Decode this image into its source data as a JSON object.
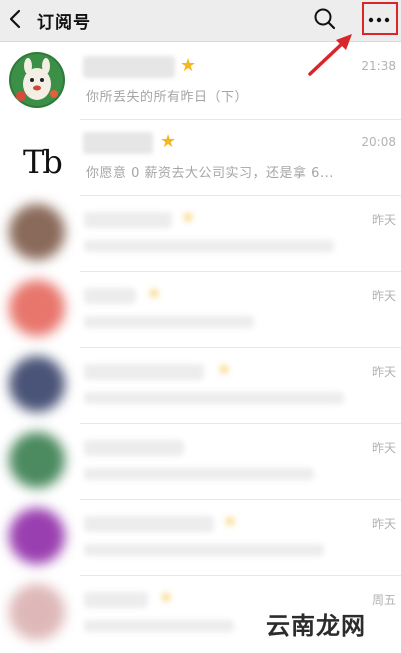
{
  "header": {
    "back_icon": "chevron-left-icon",
    "title": "订阅号",
    "search_icon": "search-icon",
    "more_icon": "more-dots-icon",
    "highlight_color": "#d9262b"
  },
  "accounts": [
    {
      "avatar": "llama-cartoon-avatar",
      "starred": true,
      "time": "21:38",
      "preview": "你所丢失的所有昨日（下）"
    },
    {
      "avatar": "tb-logo-avatar",
      "logo_text": "Tb",
      "starred": true,
      "time": "20:08",
      "preview": "你愿意 0 薪资去大公司实习，还是拿 6..."
    },
    {
      "avatar": "blurred-avatar",
      "starred": true,
      "time": "昨天",
      "color": "#8a6a5a"
    },
    {
      "avatar": "blurred-avatar",
      "starred": true,
      "time": "昨天",
      "color": "#e8766d"
    },
    {
      "avatar": "blurred-avatar",
      "starred": true,
      "time": "昨天",
      "color": "#4a5478"
    },
    {
      "avatar": "blurred-avatar",
      "starred": false,
      "time": "昨天",
      "color": "#4c8a5f"
    },
    {
      "avatar": "blurred-avatar",
      "starred": true,
      "time": "昨天",
      "color": "#9a3fb0"
    },
    {
      "avatar": "blurred-avatar",
      "starred": true,
      "time": "周五",
      "color": "#c98a8a"
    }
  ],
  "watermark": "云南龙网",
  "colors": {
    "star": "#f5b720",
    "header_bg": "#ededed"
  }
}
